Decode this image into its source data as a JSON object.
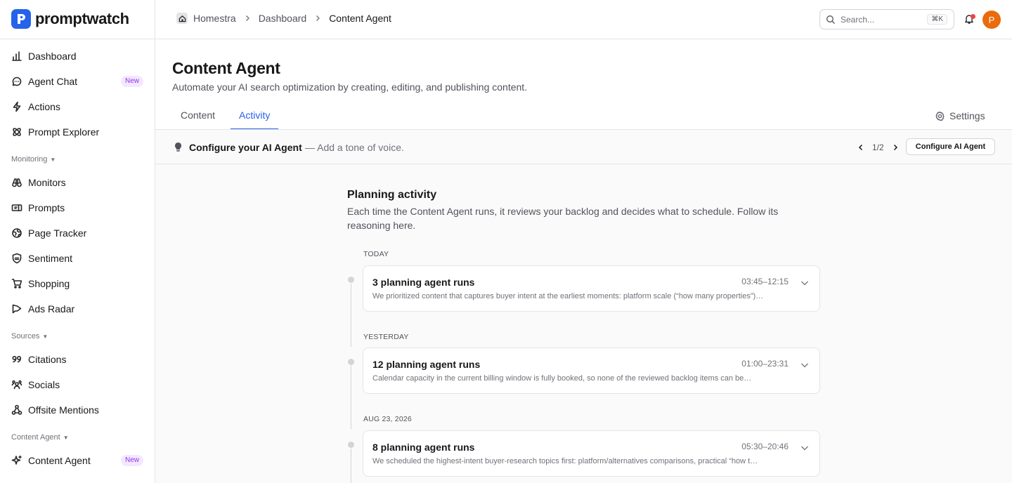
{
  "app": {
    "logo_text": "promptwatch"
  },
  "sidebar": {
    "items_top": [
      {
        "label": "Dashboard",
        "icon": "bar-chart-icon"
      },
      {
        "label": "Agent Chat",
        "icon": "chat-bubble-icon",
        "badge": "New"
      },
      {
        "label": "Actions",
        "icon": "lightning-icon"
      },
      {
        "label": "Prompt Explorer",
        "icon": "atom-icon"
      }
    ],
    "monitoring": {
      "label": "Monitoring",
      "items": [
        {
          "label": "Monitors",
          "icon": "binoculars-icon"
        },
        {
          "label": "Prompts",
          "icon": "prompt-icon"
        },
        {
          "label": "Page Tracker",
          "icon": "globe-icon"
        },
        {
          "label": "Sentiment",
          "icon": "shield-icon"
        },
        {
          "label": "Shopping",
          "icon": "cart-icon"
        },
        {
          "label": "Ads Radar",
          "icon": "megaphone-icon"
        }
      ]
    },
    "sources": {
      "label": "Sources",
      "items": [
        {
          "label": "Citations",
          "icon": "quote-icon"
        },
        {
          "label": "Socials",
          "icon": "users-icon"
        },
        {
          "label": "Offsite Mentions",
          "icon": "share-icon"
        }
      ]
    },
    "content_agent": {
      "label": "Content Agent",
      "items": [
        {
          "label": "Content Agent",
          "icon": "sparkle-icon",
          "badge": "New"
        }
      ]
    }
  },
  "topbar": {
    "breadcrumb": [
      "Homestra",
      "Dashboard",
      "Content Agent"
    ],
    "search_placeholder": "Search...",
    "search_shortcut": "⌘K",
    "avatar_initial": "P"
  },
  "header": {
    "title": "Content Agent",
    "subtitle": "Automate your AI search optimization by creating, editing, and publishing content.",
    "tabs": [
      {
        "label": "Content",
        "active": false
      },
      {
        "label": "Activity",
        "active": true
      }
    ],
    "settings_label": "Settings"
  },
  "banner": {
    "title": "Configure your AI Agent",
    "description": "— Add a tone of voice.",
    "pager": "1/2",
    "button_label": "Configure AI Agent"
  },
  "activity": {
    "title": "Planning activity",
    "subtitle": "Each time the Content Agent runs, it reviews your backlog and decides what to schedule. Follow its reasoning here.",
    "groups": [
      {
        "day": "TODAY",
        "title": "3 planning agent runs",
        "time": "03:45–12:15",
        "summary": "We prioritized content that captures buyer intent at the earliest moments: platform scale (“how many properties”)…"
      },
      {
        "day": "YESTERDAY",
        "title": "12 planning agent runs",
        "time": "01:00–23:31",
        "summary": "Calendar capacity in the current billing window is fully booked, so none of the reviewed backlog items can be…"
      },
      {
        "day": "AUG 23, 2026",
        "title": "8 planning agent runs",
        "time": "05:30–20:46",
        "summary": "We scheduled the highest-intent buyer-research topics first: platform/alternatives comparisons, practical “how t…"
      }
    ]
  }
}
